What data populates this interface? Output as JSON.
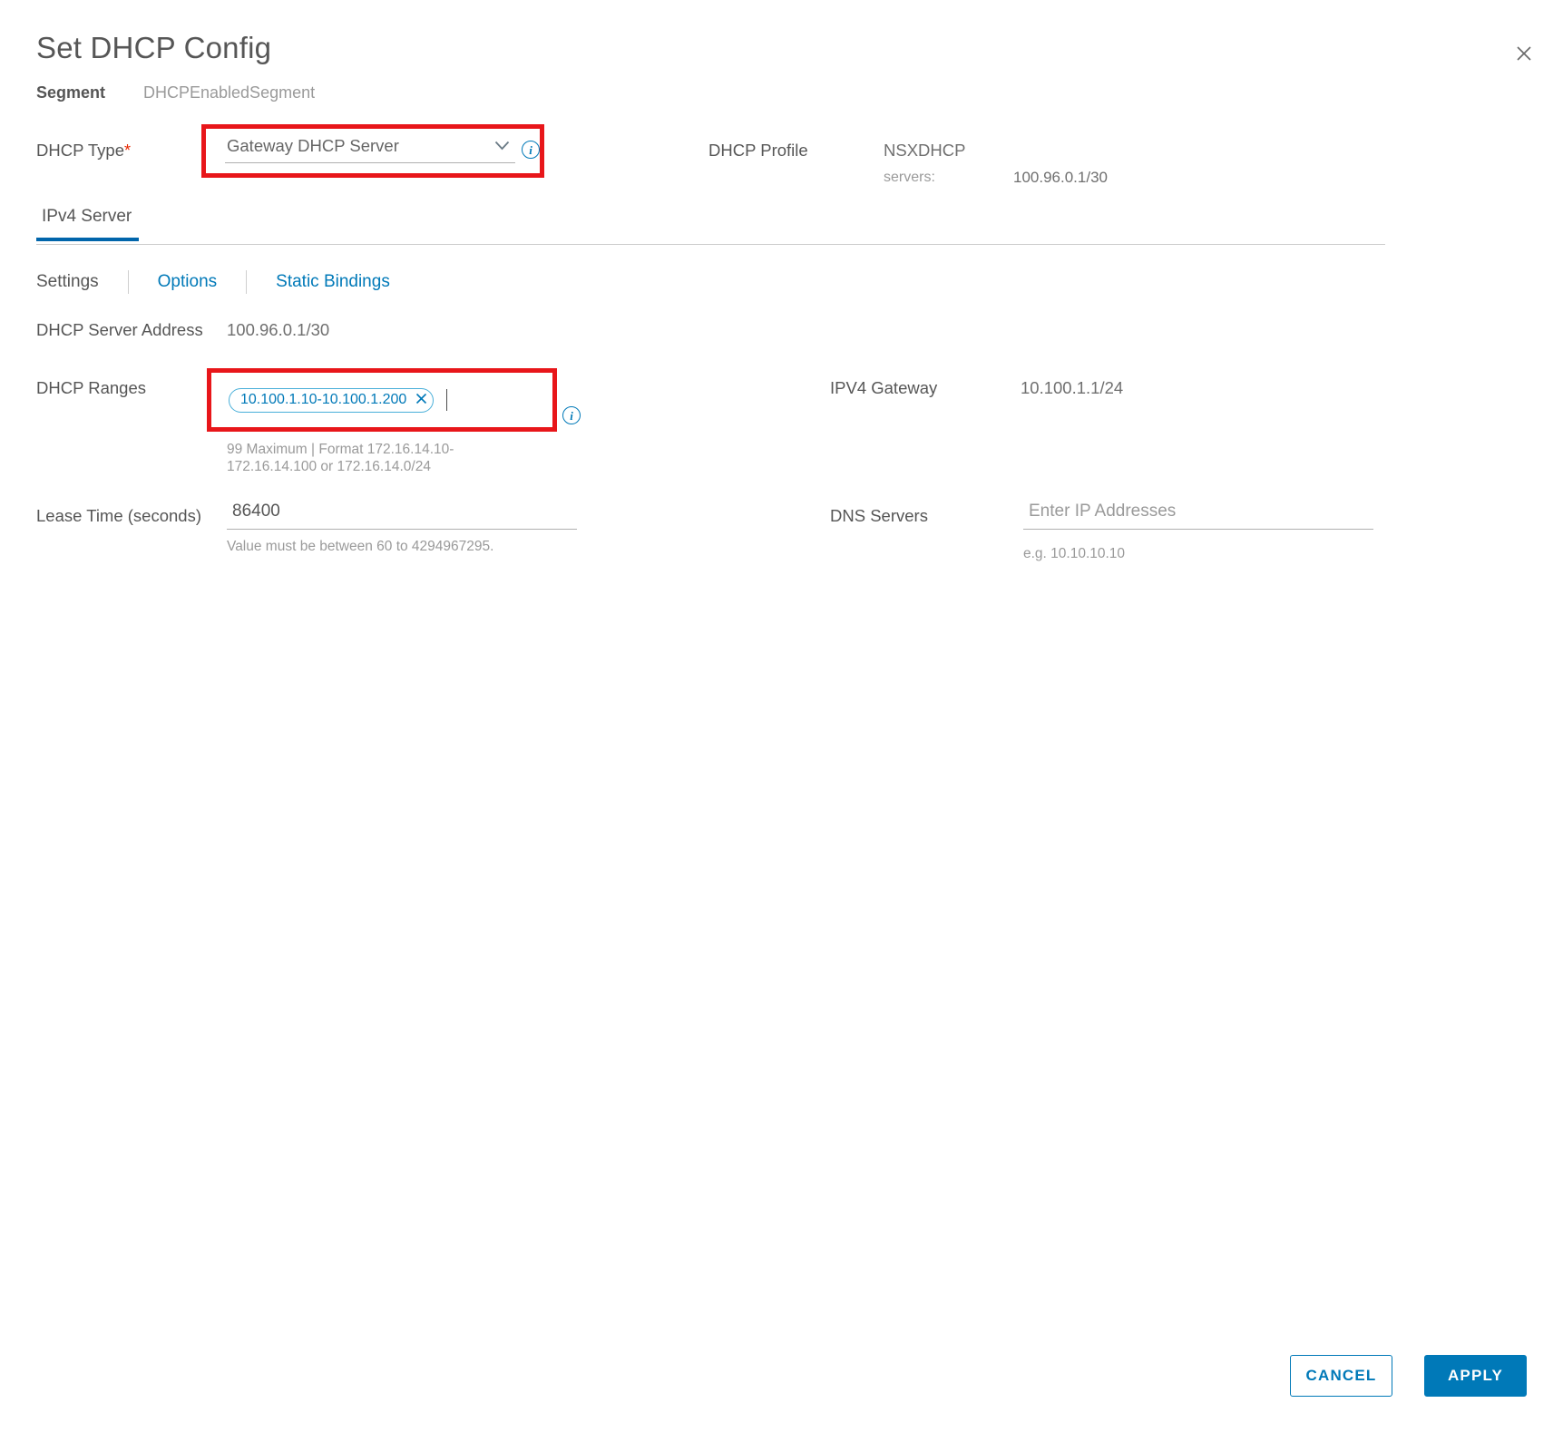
{
  "dialog": {
    "title": "Set DHCP Config",
    "close_icon": "close-icon"
  },
  "segment": {
    "label": "Segment",
    "value": "DHCPEnabledSegment"
  },
  "dhcp_type": {
    "label": "DHCP Type",
    "required_marker": "*",
    "selected": "Gateway DHCP Server",
    "chevron_icon": "chevron-down-icon",
    "info_icon": "info-icon"
  },
  "dhcp_profile": {
    "label": "DHCP Profile",
    "value": "NSXDHCP",
    "servers_label": "servers:",
    "servers_value": "100.96.0.1/30"
  },
  "tabs": [
    {
      "label": "IPv4 Server",
      "active": true
    }
  ],
  "subnav": [
    {
      "label": "Settings",
      "active": true
    },
    {
      "label": "Options",
      "active": false
    },
    {
      "label": "Static Bindings",
      "active": false
    }
  ],
  "fields": {
    "server_address": {
      "label": "DHCP Server Address",
      "value": "100.96.0.1/30"
    },
    "dhcp_ranges": {
      "label": "DHCP Ranges",
      "chips": [
        "10.100.1.10-10.100.1.200"
      ],
      "chip_remove_icon": "close-icon",
      "helper": "99 Maximum | Format 172.16.14.10-172.16.14.100 or 172.16.14.0/24",
      "info_icon": "info-icon"
    },
    "lease_time": {
      "label": "Lease Time (seconds)",
      "value": "86400",
      "helper": "Value must be between 60 to 4294967295."
    },
    "ipv4_gateway": {
      "label": "IPV4 Gateway",
      "value": "10.100.1.1/24"
    },
    "dns_servers": {
      "label": "DNS Servers",
      "value": "",
      "placeholder": "Enter IP Addresses",
      "helper": "e.g. 10.10.10.10"
    }
  },
  "footer": {
    "cancel_label": "CANCEL",
    "apply_label": "APPLY"
  },
  "colors": {
    "accent": "#0079b8",
    "tab_underline": "#0065ab",
    "highlight_box": "#e8161a",
    "required": "#e62700",
    "chip_border": "#49afd9"
  }
}
